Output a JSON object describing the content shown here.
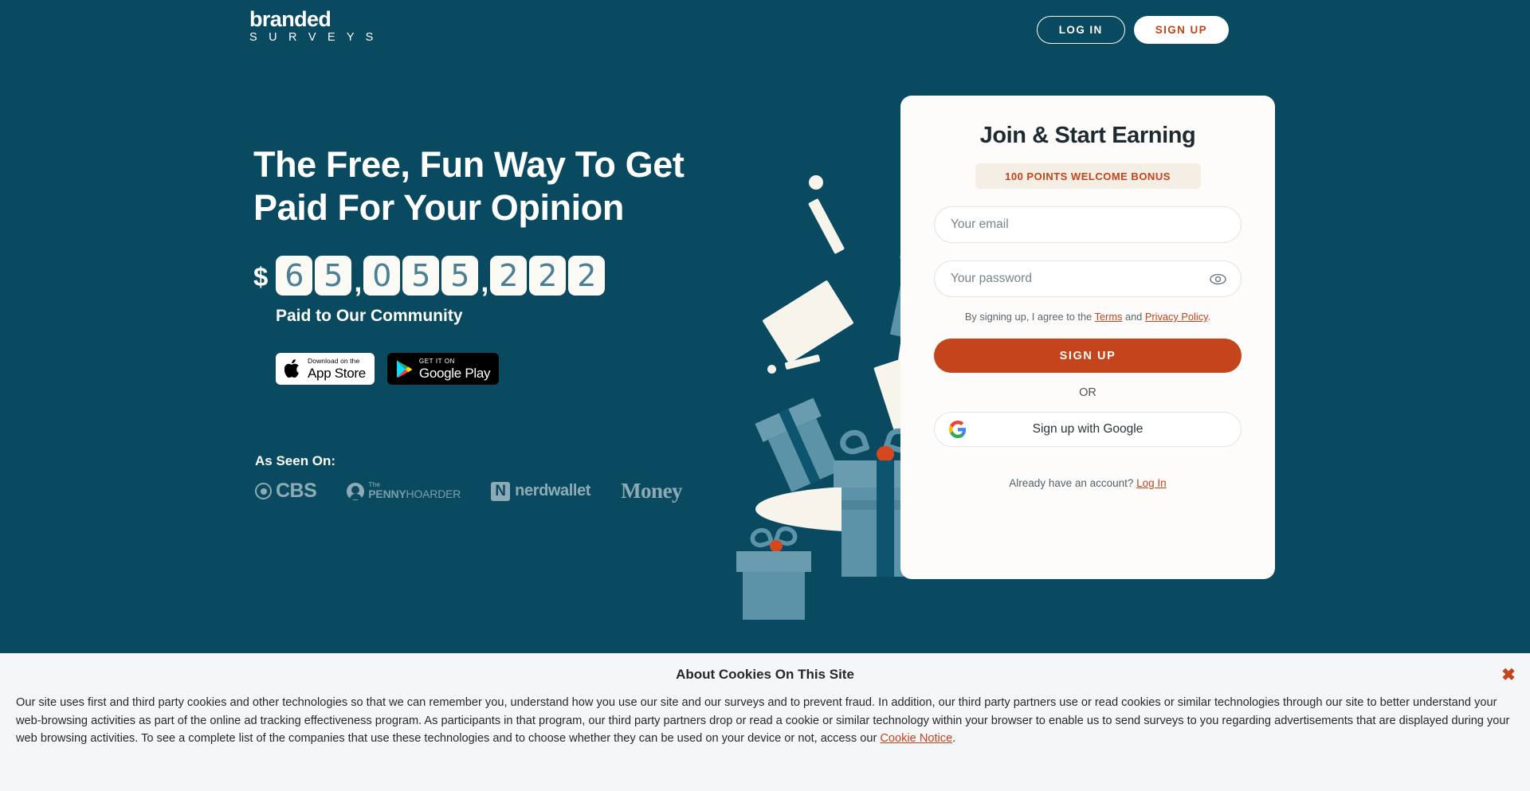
{
  "header": {
    "logo_top": "branded",
    "logo_bottom": "S U R V E Y S",
    "login_label": "LOG IN",
    "signup_label": "SIGN UP"
  },
  "hero": {
    "headline": "The Free, Fun Way To Get Paid For Your Opinion",
    "currency_symbol": "$",
    "counter_digits": [
      "6",
      "5",
      ",",
      "0",
      "5",
      "5",
      ",",
      "2",
      "2",
      "2"
    ],
    "counter_value": "65,055,222",
    "counter_caption": "Paid to Our Community",
    "app_store": {
      "small": "Download on the",
      "big": "App Store"
    },
    "google_play": {
      "small": "GET IT ON",
      "big": "Google Play"
    },
    "as_seen_title": "As Seen On:",
    "press": [
      {
        "name": "CBS",
        "text": "CBS"
      },
      {
        "name": "The Penny Hoarder",
        "line1": "The",
        "line2a": "PENNY",
        "line2b": "HOARDER"
      },
      {
        "name": "NerdWallet",
        "mark": "N",
        "text": "nerdwallet"
      },
      {
        "name": "Money",
        "text": "Money"
      }
    ]
  },
  "signup_card": {
    "title": "Join & Start Earning",
    "bonus_badge": "100 POINTS WELCOME BONUS",
    "email_placeholder": "Your email",
    "email_value": "",
    "password_placeholder": "Your password",
    "password_value": "",
    "legal_prefix": "By signing up, I agree to the ",
    "legal_terms": "Terms",
    "legal_and": " and ",
    "legal_privacy": "Privacy Policy",
    "legal_suffix": ".",
    "signup_button": "SIGN UP",
    "or_divider": "OR",
    "google_button": "Sign up with Google",
    "already_text": "Already have an account? ",
    "already_link": "Log In"
  },
  "cookie_banner": {
    "title": "About Cookies On This Site",
    "body_part1": "Our site uses first and third party cookies and other technologies so that we can remember you, understand how you use our site and our surveys and to prevent fraud. In addition, our third party partners use or read cookies or similar technologies through our site to better understand your web-browsing activities as part of the online ad tracking effectiveness program. As participants in that program, our third party partners drop or read a cookie or similar technology within your browser to enable us to send surveys to you regarding advertisements that are displayed during your web browsing activities. To see a complete list of the companies that use these technologies and to choose whether they can be used on your device or not, access our ",
    "link_label": "Cookie Notice",
    "body_part2": ".",
    "close_label": "✖"
  },
  "colors": {
    "brand_teal": "#0a4a60",
    "accent_rust": "#c4441c",
    "card_bg": "#fdfcfa",
    "counter_digit": "#4a7f95",
    "gift_blue": "#5d93a8",
    "cookie_bg": "#f5f6f8"
  }
}
